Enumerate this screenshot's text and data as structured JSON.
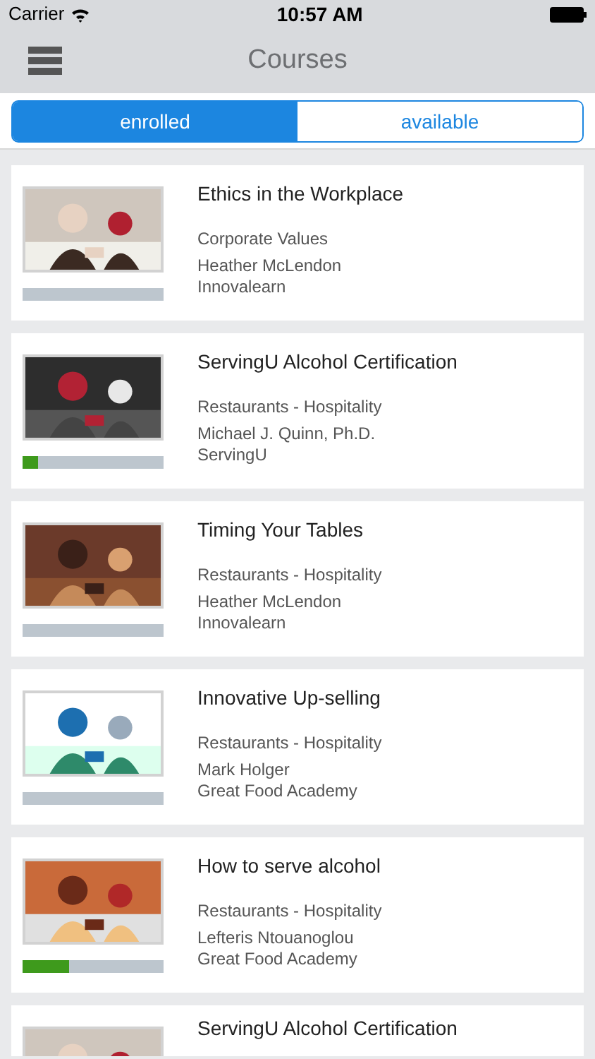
{
  "status_bar": {
    "carrier": "Carrier",
    "time": "10:57 AM"
  },
  "nav_bar": {
    "title": "Courses"
  },
  "tabs": [
    {
      "label": "enrolled",
      "selected": true
    },
    {
      "label": "available",
      "selected": false
    }
  ],
  "courses": [
    {
      "title": "Ethics in the Workplace",
      "category": "Corporate Values",
      "author": "Heather McLendon",
      "provider": "Innovalearn",
      "level": 0
    },
    {
      "title": "ServingU Alcohol Certification",
      "category": "Restaurants - Hospitality",
      "author": "Michael J. Quinn, Ph.D.",
      "provider": "ServingU",
      "level": 0.11
    },
    {
      "title": "Timing Your Tables",
      "category": "Restaurants - Hospitality",
      "author": "Heather McLendon",
      "provider": "Innovalearn",
      "level": 0
    },
    {
      "title": "Innovative Up-selling",
      "category": "Restaurants - Hospitality",
      "author": "Mark Holger",
      "provider": "Great Food Academy",
      "level": 0
    },
    {
      "title": "How to serve alcohol",
      "category": "Restaurants - Hospitality",
      "author": "Lefteris Ntouanoglou",
      "provider": "Great Food Academy",
      "level": 0.33
    },
    {
      "title": "ServingU Alcohol Certification"
    }
  ]
}
